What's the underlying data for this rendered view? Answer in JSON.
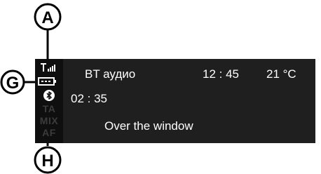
{
  "callouts": {
    "a": "A",
    "g": "G",
    "h": "H"
  },
  "display": {
    "source": "BT аудио",
    "clock": "12 : 45",
    "temperature": "21 °C",
    "track_time": "02 : 35",
    "track_title": "Over the window"
  },
  "status_labels": {
    "ta": "TA",
    "mix": "MIX",
    "af": "AF"
  },
  "icons": {
    "signal": "signal-strength-icon",
    "battery": "battery-icon",
    "bluetooth": "bluetooth-icon"
  }
}
